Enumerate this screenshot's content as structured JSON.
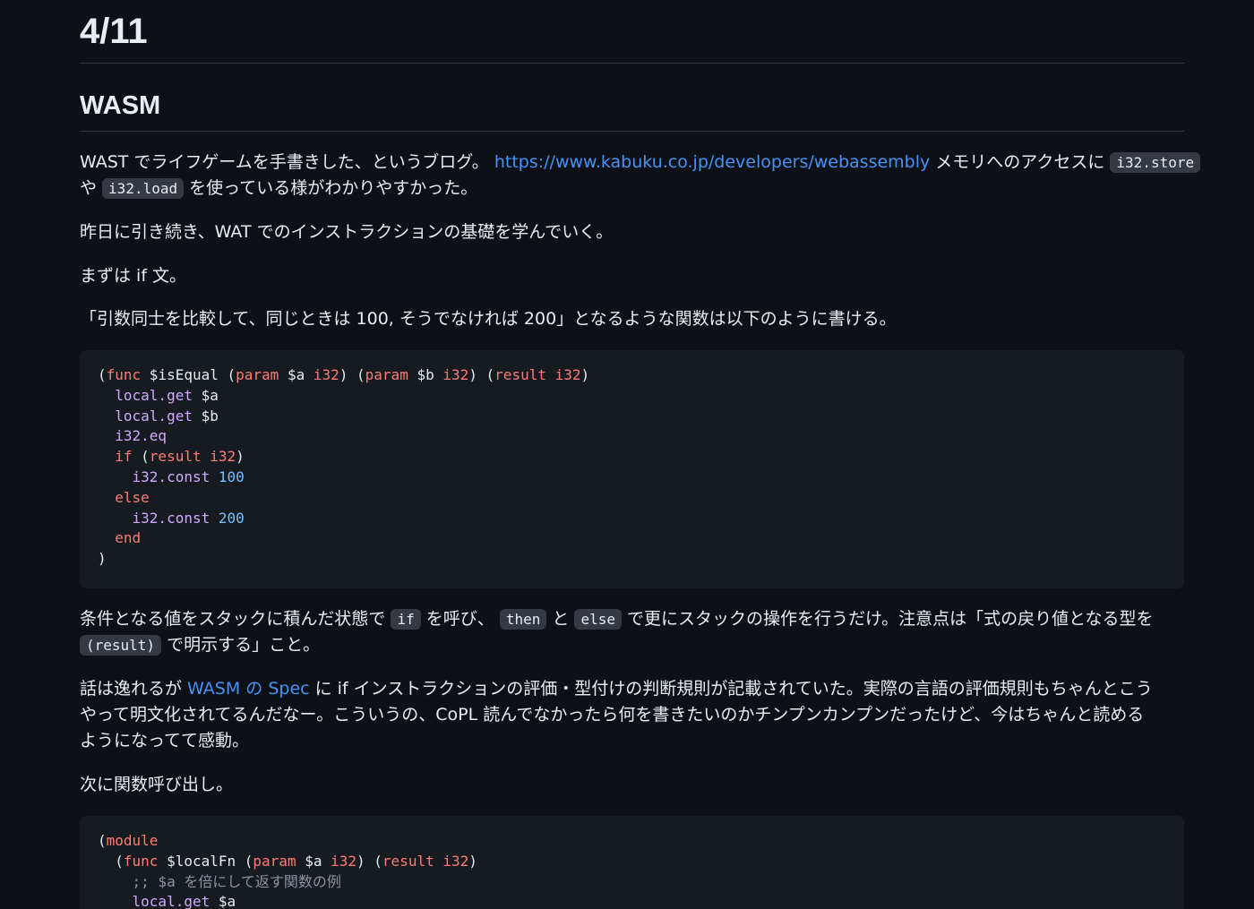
{
  "heading_date": "4/11",
  "heading_section": "WASM",
  "p1": {
    "text_a": "WAST でライフゲームを手書きした、というブログ。 ",
    "link": "https://www.kabuku.co.jp/developers/webassembly",
    "text_b": " メモリへのアクセスに ",
    "code_store": "i32.store",
    "text_c": "や ",
    "code_load": "i32.load",
    "text_d": " を使っている様がわかりやすかった。"
  },
  "p2": "昨日に引き続き、WAT でのインストラクションの基礎を学んでいく。",
  "p3": "まずは if 文。",
  "p4": "「引数同士を比較して、同じときは 100, そうでなければ 200」となるような関数は以下のように書ける。",
  "code1": {
    "l1": {
      "p0": "(",
      "k0": "func",
      "p1": " $isEqual (",
      "k1": "param",
      "p2": " $a ",
      "k2": "i32",
      "p3": ") (",
      "k3": "param",
      "p4": " $b ",
      "k4": "i32",
      "p5": ") (",
      "k5": "result",
      "p6": " ",
      "k6": "i32",
      "p7": ")"
    },
    "l2": {
      "ind": "  ",
      "f": "local.get",
      "r": " $a"
    },
    "l3": {
      "ind": "  ",
      "f": "local.get",
      "r": " $b"
    },
    "l4": {
      "ind": "  ",
      "f": "i32.eq"
    },
    "l5": {
      "ind": "  ",
      "k0": "if",
      "p0": " (",
      "k1": "result",
      "p1": " ",
      "k2": "i32",
      "p2": ")"
    },
    "l6": {
      "ind": "    ",
      "f": "i32.const",
      "sp": " ",
      "n": "100"
    },
    "l7": {
      "ind": "  ",
      "k": "else"
    },
    "l8": {
      "ind": "    ",
      "f": "i32.const",
      "sp": " ",
      "n": "200"
    },
    "l9": {
      "ind": "  ",
      "k": "end"
    },
    "l10": ")"
  },
  "p5": {
    "a": "条件となる値をスタックに積んだ状態で ",
    "c_if": "if",
    "b": " を呼び、 ",
    "c_then": "then",
    "c": " と ",
    "c_else": "else",
    "d": " で更にスタックの操作を行うだけ。注意点は「式の戻り値となる型を",
    "c_result": "(result)",
    "e": " で明示する」こと。"
  },
  "p6": {
    "a": "話は逸れるが ",
    "link": "WASM の Spec",
    "b": " に if インストラクションの評価・型付けの判断規則が記載されていた。実際の言語の評価規則もちゃんとこう",
    "line2": "やって明文化されてるんだなー。こういうの、CoPL 読んでなかったら何を書きたいのかチンプンカンプンだったけど、今はちゃんと読める",
    "line3": "ようになってて感動。"
  },
  "p7": "次に関数呼び出し。",
  "code2": {
    "l1": {
      "p0": "(",
      "k": "module"
    },
    "l2": {
      "ind": "  (",
      "k0": "func",
      "p0": " $localFn (",
      "k1": "param",
      "p1": " $a ",
      "k2": "i32",
      "p2": ") (",
      "k3": "result",
      "p3": " ",
      "k4": "i32",
      "p4": ")"
    },
    "l3": {
      "ind": "    ",
      "c": ";; $a を倍にして返す関数の例"
    },
    "l4": {
      "ind": "    ",
      "f": "local.get",
      "r": " $a"
    }
  },
  "colors": {
    "background": "#0d1117",
    "text": "#e6edf3",
    "link": "#4493f8",
    "code_bg": "#161b22",
    "inline_code_bg": "#343942",
    "keyword": "#ff7b72",
    "function": "#d2a8ff",
    "number": "#79c0ff",
    "comment": "#8b949e"
  }
}
